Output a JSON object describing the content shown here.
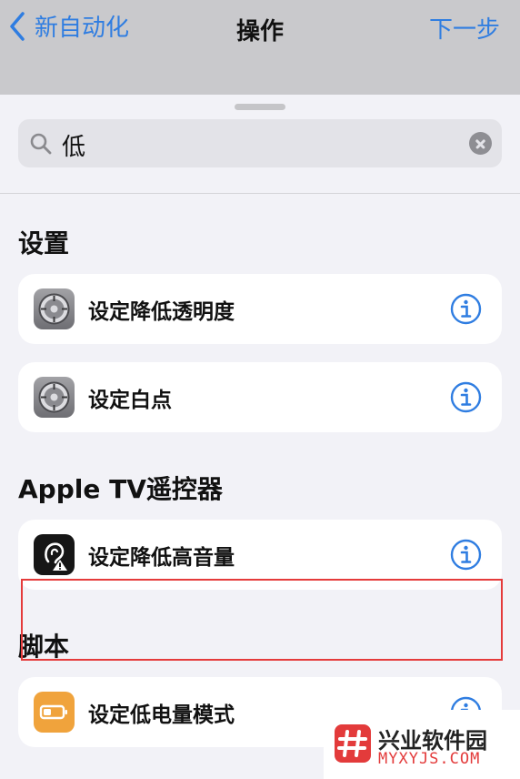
{
  "nav": {
    "back_label": "新自动化",
    "title": "操作",
    "next_label": "下一步"
  },
  "search": {
    "query": "低"
  },
  "sections": [
    {
      "title": "设置",
      "items": [
        {
          "label": "设定降低透明度",
          "icon": "settings-gear-icon"
        },
        {
          "label": "设定白点",
          "icon": "settings-gear-icon"
        }
      ]
    },
    {
      "title": "Apple TV遥控器",
      "items": [
        {
          "label": "设定降低高音量",
          "icon": "hearing-ear-icon"
        }
      ]
    },
    {
      "title": "脚本",
      "items": [
        {
          "label": "设定低电量模式",
          "icon": "low-battery-icon",
          "highlighted": true
        }
      ]
    }
  ],
  "watermark": {
    "title": "兴业软件园",
    "subtitle": "MYXYJS.COM"
  },
  "colors": {
    "accent": "#2f7de1",
    "highlight_border": "#e53b3b",
    "battery_icon": "#f0a33c"
  }
}
